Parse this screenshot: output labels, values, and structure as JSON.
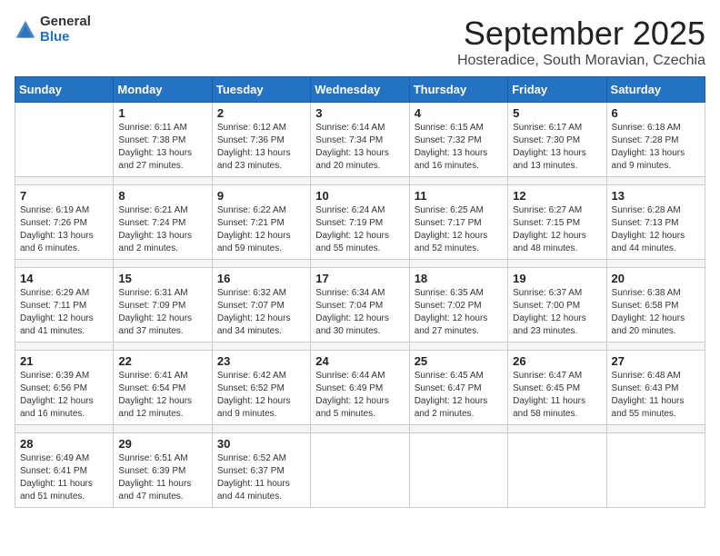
{
  "logo": {
    "general": "General",
    "blue": "Blue"
  },
  "header": {
    "month": "September 2025",
    "location": "Hosteradice, South Moravian, Czechia"
  },
  "weekdays": [
    "Sunday",
    "Monday",
    "Tuesday",
    "Wednesday",
    "Thursday",
    "Friday",
    "Saturday"
  ],
  "weeks": [
    [
      {
        "day": "",
        "info": ""
      },
      {
        "day": "1",
        "info": "Sunrise: 6:11 AM\nSunset: 7:38 PM\nDaylight: 13 hours\nand 27 minutes."
      },
      {
        "day": "2",
        "info": "Sunrise: 6:12 AM\nSunset: 7:36 PM\nDaylight: 13 hours\nand 23 minutes."
      },
      {
        "day": "3",
        "info": "Sunrise: 6:14 AM\nSunset: 7:34 PM\nDaylight: 13 hours\nand 20 minutes."
      },
      {
        "day": "4",
        "info": "Sunrise: 6:15 AM\nSunset: 7:32 PM\nDaylight: 13 hours\nand 16 minutes."
      },
      {
        "day": "5",
        "info": "Sunrise: 6:17 AM\nSunset: 7:30 PM\nDaylight: 13 hours\nand 13 minutes."
      },
      {
        "day": "6",
        "info": "Sunrise: 6:18 AM\nSunset: 7:28 PM\nDaylight: 13 hours\nand 9 minutes."
      }
    ],
    [
      {
        "day": "7",
        "info": "Sunrise: 6:19 AM\nSunset: 7:26 PM\nDaylight: 13 hours\nand 6 minutes."
      },
      {
        "day": "8",
        "info": "Sunrise: 6:21 AM\nSunset: 7:24 PM\nDaylight: 13 hours\nand 2 minutes."
      },
      {
        "day": "9",
        "info": "Sunrise: 6:22 AM\nSunset: 7:21 PM\nDaylight: 12 hours\nand 59 minutes."
      },
      {
        "day": "10",
        "info": "Sunrise: 6:24 AM\nSunset: 7:19 PM\nDaylight: 12 hours\nand 55 minutes."
      },
      {
        "day": "11",
        "info": "Sunrise: 6:25 AM\nSunset: 7:17 PM\nDaylight: 12 hours\nand 52 minutes."
      },
      {
        "day": "12",
        "info": "Sunrise: 6:27 AM\nSunset: 7:15 PM\nDaylight: 12 hours\nand 48 minutes."
      },
      {
        "day": "13",
        "info": "Sunrise: 6:28 AM\nSunset: 7:13 PM\nDaylight: 12 hours\nand 44 minutes."
      }
    ],
    [
      {
        "day": "14",
        "info": "Sunrise: 6:29 AM\nSunset: 7:11 PM\nDaylight: 12 hours\nand 41 minutes."
      },
      {
        "day": "15",
        "info": "Sunrise: 6:31 AM\nSunset: 7:09 PM\nDaylight: 12 hours\nand 37 minutes."
      },
      {
        "day": "16",
        "info": "Sunrise: 6:32 AM\nSunset: 7:07 PM\nDaylight: 12 hours\nand 34 minutes."
      },
      {
        "day": "17",
        "info": "Sunrise: 6:34 AM\nSunset: 7:04 PM\nDaylight: 12 hours\nand 30 minutes."
      },
      {
        "day": "18",
        "info": "Sunrise: 6:35 AM\nSunset: 7:02 PM\nDaylight: 12 hours\nand 27 minutes."
      },
      {
        "day": "19",
        "info": "Sunrise: 6:37 AM\nSunset: 7:00 PM\nDaylight: 12 hours\nand 23 minutes."
      },
      {
        "day": "20",
        "info": "Sunrise: 6:38 AM\nSunset: 6:58 PM\nDaylight: 12 hours\nand 20 minutes."
      }
    ],
    [
      {
        "day": "21",
        "info": "Sunrise: 6:39 AM\nSunset: 6:56 PM\nDaylight: 12 hours\nand 16 minutes."
      },
      {
        "day": "22",
        "info": "Sunrise: 6:41 AM\nSunset: 6:54 PM\nDaylight: 12 hours\nand 12 minutes."
      },
      {
        "day": "23",
        "info": "Sunrise: 6:42 AM\nSunset: 6:52 PM\nDaylight: 12 hours\nand 9 minutes."
      },
      {
        "day": "24",
        "info": "Sunrise: 6:44 AM\nSunset: 6:49 PM\nDaylight: 12 hours\nand 5 minutes."
      },
      {
        "day": "25",
        "info": "Sunrise: 6:45 AM\nSunset: 6:47 PM\nDaylight: 12 hours\nand 2 minutes."
      },
      {
        "day": "26",
        "info": "Sunrise: 6:47 AM\nSunset: 6:45 PM\nDaylight: 11 hours\nand 58 minutes."
      },
      {
        "day": "27",
        "info": "Sunrise: 6:48 AM\nSunset: 6:43 PM\nDaylight: 11 hours\nand 55 minutes."
      }
    ],
    [
      {
        "day": "28",
        "info": "Sunrise: 6:49 AM\nSunset: 6:41 PM\nDaylight: 11 hours\nand 51 minutes."
      },
      {
        "day": "29",
        "info": "Sunrise: 6:51 AM\nSunset: 6:39 PM\nDaylight: 11 hours\nand 47 minutes."
      },
      {
        "day": "30",
        "info": "Sunrise: 6:52 AM\nSunset: 6:37 PM\nDaylight: 11 hours\nand 44 minutes."
      },
      {
        "day": "",
        "info": ""
      },
      {
        "day": "",
        "info": ""
      },
      {
        "day": "",
        "info": ""
      },
      {
        "day": "",
        "info": ""
      }
    ]
  ]
}
